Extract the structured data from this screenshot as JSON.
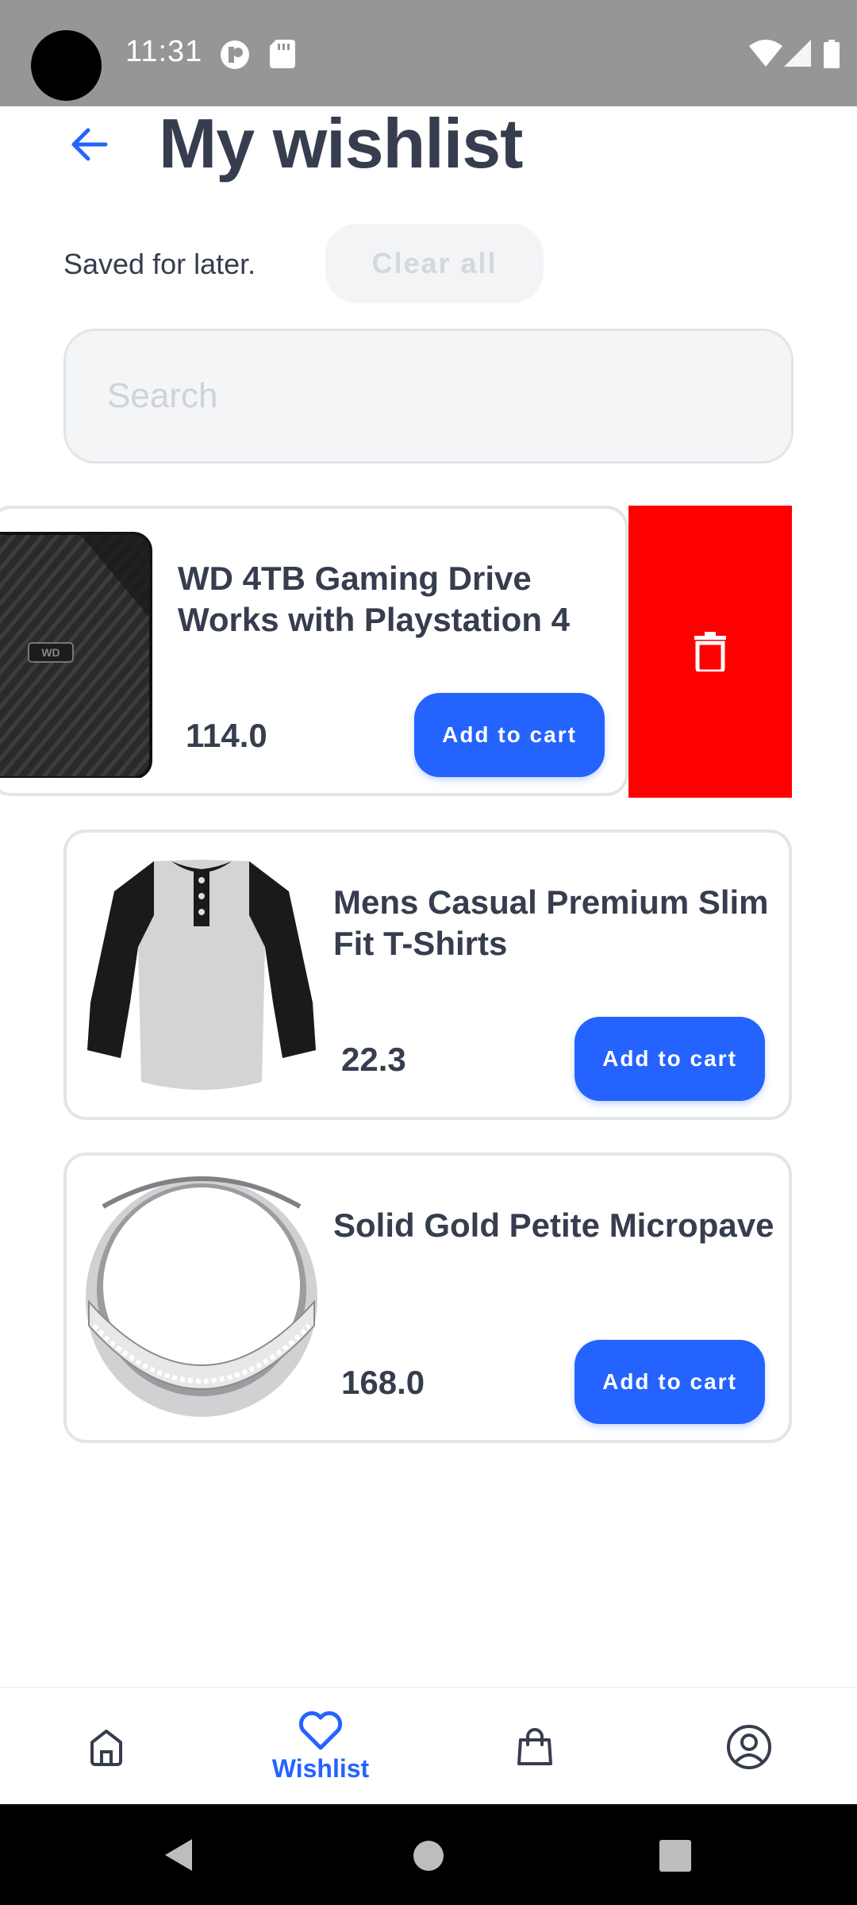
{
  "status_bar": {
    "time": "11:31"
  },
  "header": {
    "title": "My wishlist",
    "subtitle": "Saved for later.",
    "clear_label": "Clear all"
  },
  "search": {
    "placeholder": "Search",
    "value": ""
  },
  "items": [
    {
      "title": "WD 4TB Gaming Drive Works with Playstation 4",
      "price": "114.0",
      "button": "Add to cart",
      "image": "hard-drive",
      "swiped": true
    },
    {
      "title": "Mens Casual Premium Slim Fit T-Shirts",
      "price": "22.3",
      "button": "Add to cart",
      "image": "t-shirt"
    },
    {
      "title": "Solid Gold Petite Micropave",
      "price": "168.0",
      "button": "Add to cart",
      "image": "ring"
    }
  ],
  "delete_action": {
    "icon": "trash-icon",
    "color": "#ff0000"
  },
  "bottom_nav": {
    "active": "Wishlist",
    "active_label": "Wishlist",
    "icons": [
      "home-icon",
      "heart-icon",
      "shopping-bag-icon",
      "profile-icon"
    ]
  },
  "colors": {
    "accent": "#2563ff",
    "text": "#363d4e",
    "status_bar": "#969696",
    "delete": "#ff0000"
  }
}
